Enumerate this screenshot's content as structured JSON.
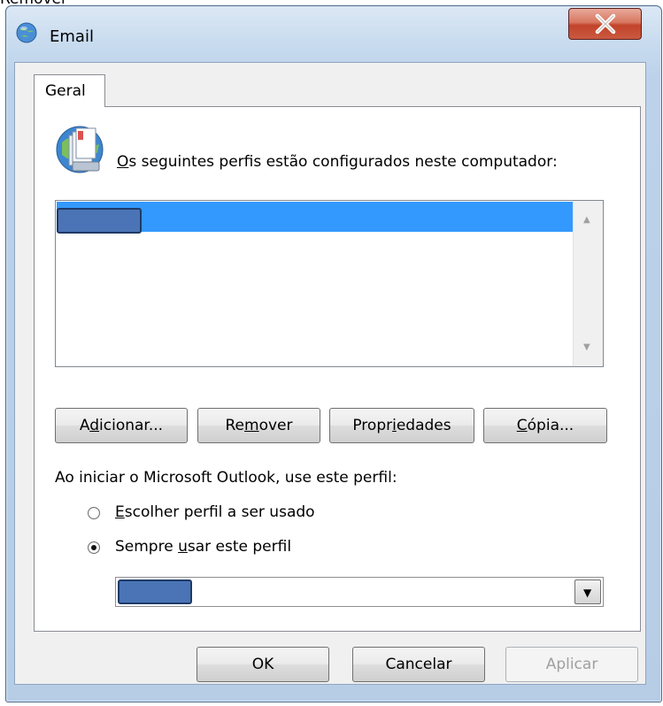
{
  "top_caption": "Remover",
  "window": {
    "title": "Email"
  },
  "tab": {
    "label": "Geral"
  },
  "profiles": {
    "label_prefix": "O",
    "label_rest": "s seguintes perfis estão configurados neste computador:"
  },
  "buttons": {
    "add": {
      "pre": "A",
      "key": "d",
      "post": "icionar..."
    },
    "remove": {
      "pre": "Re",
      "key": "m",
      "post": "over"
    },
    "properties": {
      "pre": "Propr",
      "key": "i",
      "post": "edades"
    },
    "copy": {
      "pre": "",
      "key": "C",
      "post": "ópia..."
    }
  },
  "startup": {
    "label": "Ao iniciar o Microsoft Outlook, use este perfil:",
    "options": [
      {
        "key": "E",
        "rest": "scolher perfil a ser usado",
        "selected": false
      },
      {
        "pre": "Sempre ",
        "key": "u",
        "rest": "sar este perfil",
        "selected": true
      }
    ]
  },
  "footer": {
    "ok": "OK",
    "cancel": "Cancelar",
    "apply": "Aplicar"
  },
  "colors": {
    "selection": "#3399ff",
    "close_red": "#c2432a",
    "redaction": "#4a74b6"
  }
}
